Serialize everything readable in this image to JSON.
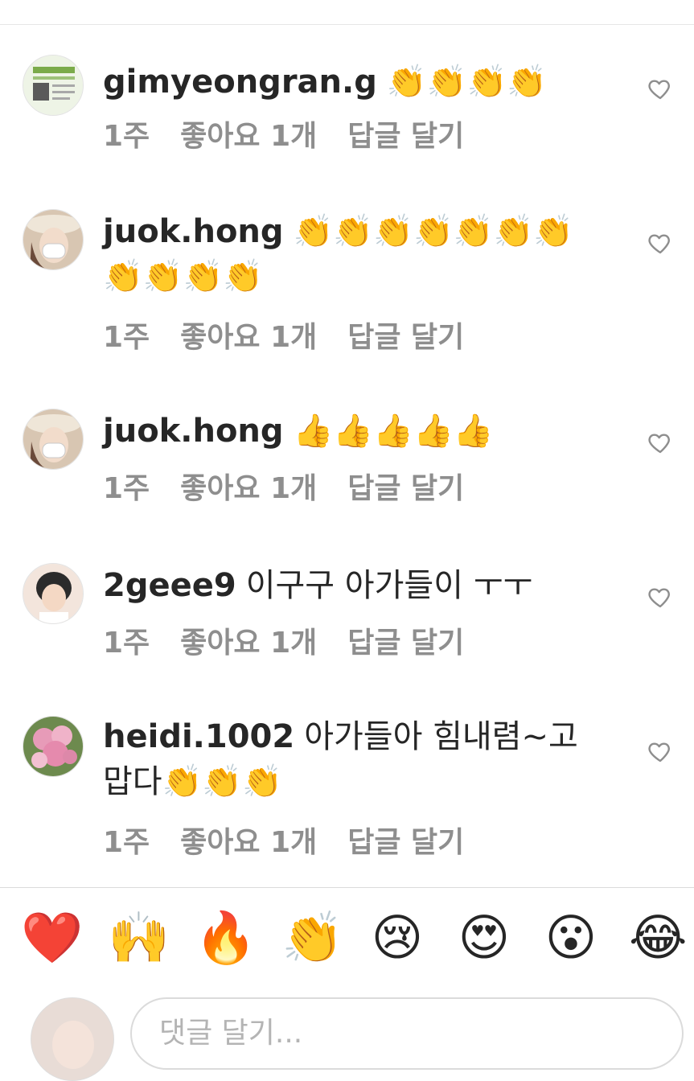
{
  "comments": [
    {
      "username": "gimyeongran.g",
      "text": "👏👏👏👏",
      "time": "1주",
      "likes": "좋아요 1개",
      "reply": "답글 달기",
      "avatar_colors": [
        "#eef4e6",
        "#7bab4a"
      ]
    },
    {
      "username": "juok.hong",
      "text": "👏👏👏👏👏👏👏👏👏👏👏",
      "time": "1주",
      "likes": "좋아요 1개",
      "reply": "답글 달기",
      "avatar_colors": [
        "#d8c6b2",
        "#6a4a3a"
      ]
    },
    {
      "username": "juok.hong",
      "text": "👍👍👍👍👍",
      "time": "1주",
      "likes": "좋아요 1개",
      "reply": "답글 달기",
      "avatar_colors": [
        "#d8c6b2",
        "#6a4a3a"
      ]
    },
    {
      "username": "2geee9",
      "text": "이구구 아가들이 ㅜㅜ",
      "time": "1주",
      "likes": "좋아요 1개",
      "reply": "답글 달기",
      "avatar_colors": [
        "#f3e5dc",
        "#2b2b2b"
      ]
    },
    {
      "username": "heidi.1002",
      "text": "아가들아 힘내렴~고맙다👏👏👏",
      "time": "1주",
      "likes": "좋아요 1개",
      "reply": "답글 달기",
      "avatar_colors": [
        "#e79bb8",
        "#6d8a4e"
      ]
    }
  ],
  "quick_reactions": [
    "❤️",
    "🙌",
    "🔥",
    "👏",
    "😢",
    "😍",
    "😮",
    "😂"
  ],
  "composer": {
    "placeholder": "댓글 달기..."
  },
  "icons": {
    "like": "heart-outline-icon"
  },
  "colors": {
    "text": "#262626",
    "meta": "#8e8e8e",
    "divider": "#dbdbdb"
  }
}
